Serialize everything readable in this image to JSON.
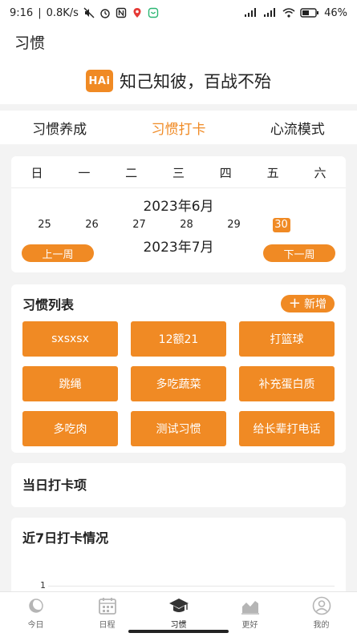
{
  "status_bar": {
    "time": "9:16",
    "speed": "0.8K/s",
    "battery": "46%"
  },
  "header": {
    "title": "习惯"
  },
  "slogan": {
    "logo_text": "HAi",
    "text": "知己知彼，百战不殆"
  },
  "tabs": [
    {
      "label": "习惯养成"
    },
    {
      "label": "习惯打卡"
    },
    {
      "label": "心流模式"
    }
  ],
  "calendar": {
    "weekdays": [
      "日",
      "一",
      "二",
      "三",
      "四",
      "五",
      "六"
    ],
    "month_a": "2023年6月",
    "days": [
      "25",
      "26",
      "27",
      "28",
      "29",
      "30"
    ],
    "selected_day": "30",
    "month_b": "2023年7月",
    "prev_week": "上一周",
    "next_week": "下一周"
  },
  "habit_list": {
    "title": "习惯列表",
    "add_label": "新增",
    "items": [
      "sxsxsx",
      "12额21",
      "打篮球",
      "跳绳",
      "多吃蔬菜",
      "补充蛋白质",
      "多吃肉",
      "测试习惯",
      "给长辈打电话"
    ]
  },
  "today": {
    "title": "当日打卡项"
  },
  "week_chart": {
    "title": "近7日打卡情况",
    "y_tick": "1"
  },
  "bottom_nav": [
    {
      "label": "今日",
      "icon": "moon-icon"
    },
    {
      "label": "日程",
      "icon": "calendar-icon"
    },
    {
      "label": "习惯",
      "icon": "graduation-cap-icon"
    },
    {
      "label": "更好",
      "icon": "trend-chart-icon"
    },
    {
      "label": "我的",
      "icon": "user-icon"
    }
  ],
  "colors": {
    "accent": "#f08a24",
    "background": "#f3f3f3"
  }
}
